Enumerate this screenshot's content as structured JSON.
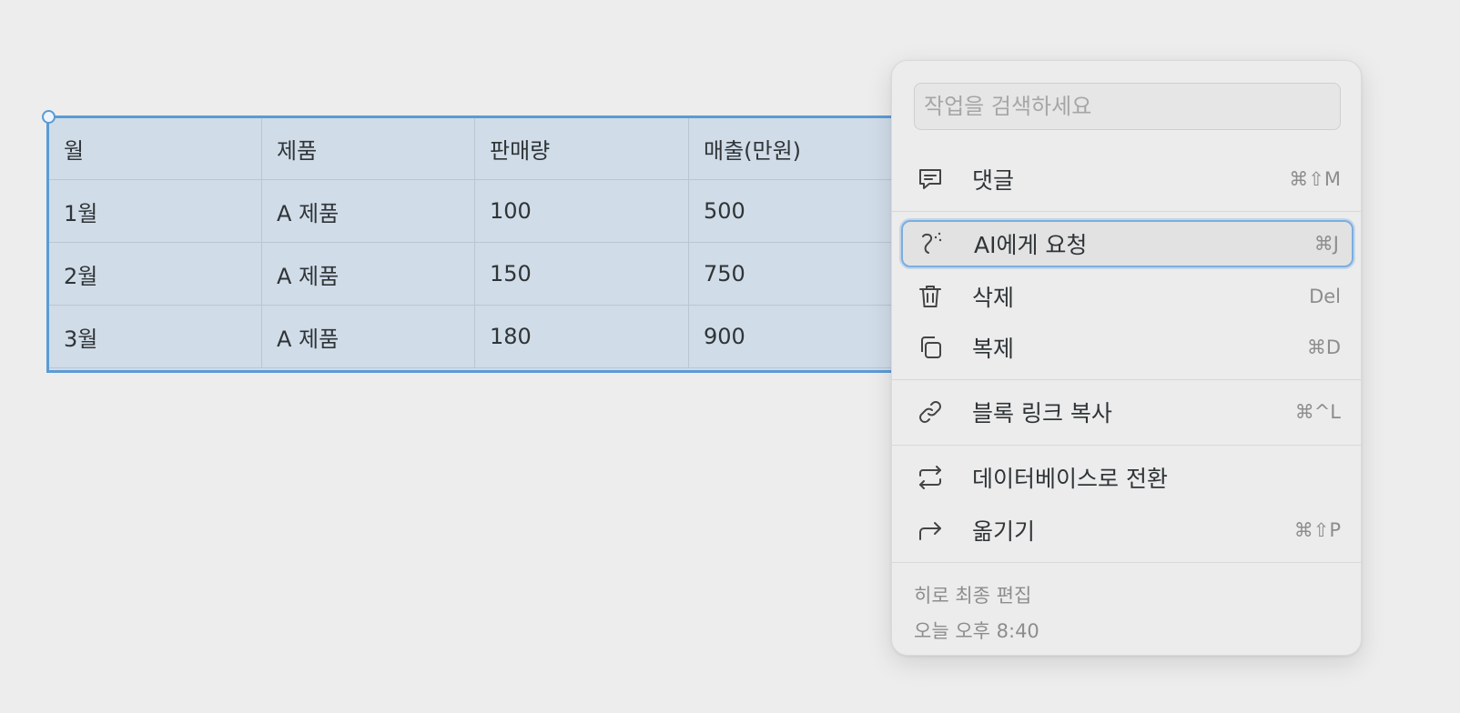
{
  "table": {
    "headers": [
      "월",
      "제품",
      "판매량",
      "매출(만원)"
    ],
    "rows": [
      [
        "1월",
        "A 제품",
        "100",
        "500"
      ],
      [
        "2월",
        "A 제품",
        "150",
        "750"
      ],
      [
        "3월",
        "A 제품",
        "180",
        "900"
      ]
    ]
  },
  "menu": {
    "search_placeholder": "작업을 검색하세요",
    "items": [
      {
        "label": "댓글",
        "shortcut": "⌘⇧M",
        "icon": "comment-icon"
      },
      {
        "label": "AI에게 요청",
        "shortcut": "⌘J",
        "icon": "ai-sparkle-icon"
      },
      {
        "label": "삭제",
        "shortcut": "Del",
        "icon": "trash-icon"
      },
      {
        "label": "복제",
        "shortcut": "⌘D",
        "icon": "duplicate-icon"
      },
      {
        "label": "블록 링크 복사",
        "shortcut": "⌘^L",
        "icon": "link-icon"
      },
      {
        "label": "데이터베이스로 전환",
        "shortcut": "",
        "icon": "convert-icon"
      },
      {
        "label": "옮기기",
        "shortcut": "⌘⇧P",
        "icon": "move-arrow-icon"
      }
    ],
    "footer": {
      "edited_by": "히로 최종 편집",
      "edited_time": "오늘 오후 8:40"
    }
  },
  "colors": {
    "selection_blue": "#5b9bd5",
    "table_fill": "#d0dce8",
    "menu_bg": "#ececec"
  }
}
